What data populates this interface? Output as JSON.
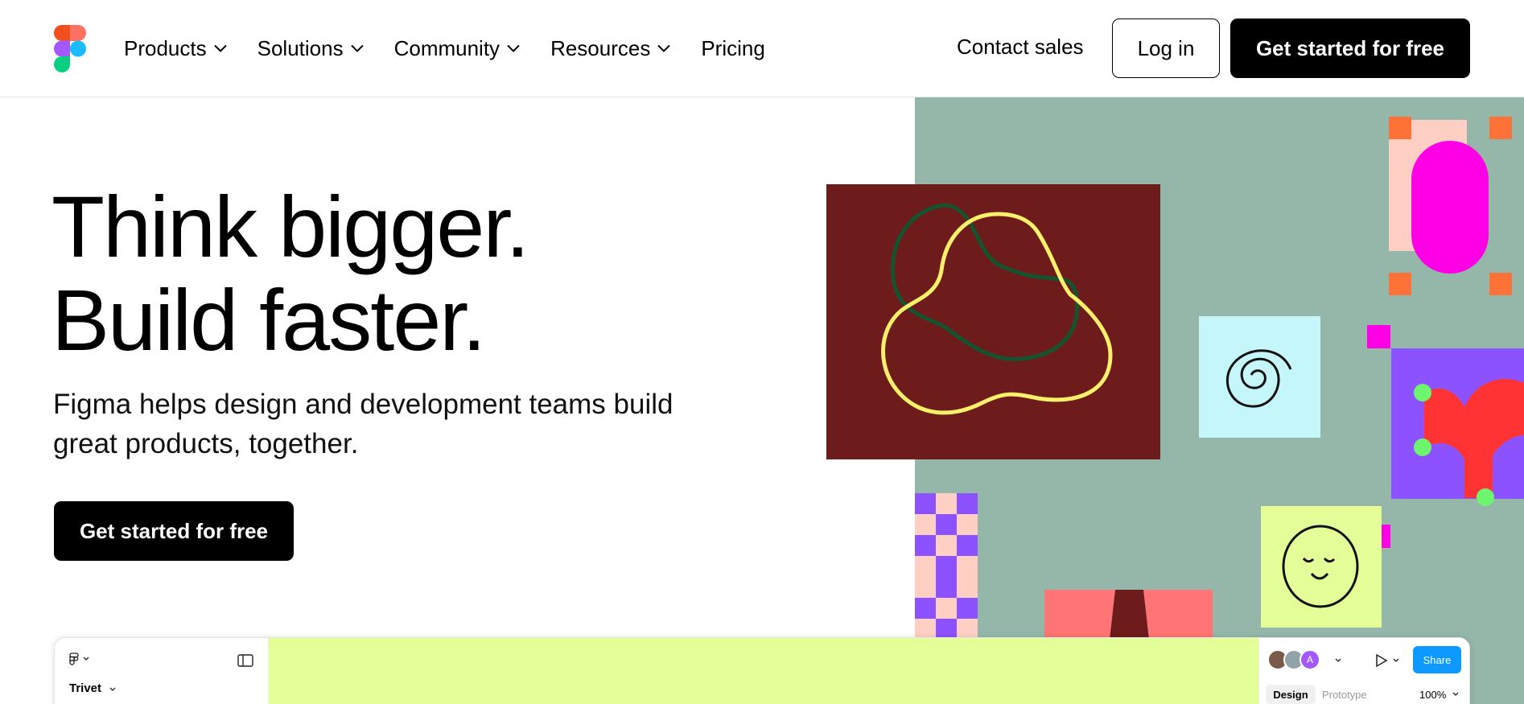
{
  "brand": {
    "colors": {
      "red": "#f24e1e",
      "orange": "#ff7262",
      "purple": "#a259ff",
      "blue": "#1abcfe",
      "green": "#0acf83"
    }
  },
  "nav": {
    "items": [
      {
        "label": "Products",
        "has_menu": true
      },
      {
        "label": "Solutions",
        "has_menu": true
      },
      {
        "label": "Community",
        "has_menu": true
      },
      {
        "label": "Resources",
        "has_menu": true
      },
      {
        "label": "Pricing",
        "has_menu": false
      }
    ],
    "contact_label": "Contact sales",
    "login_label": "Log in",
    "cta_label": "Get started for free"
  },
  "hero": {
    "title_line1": "Think bigger.",
    "title_line2": "Build faster.",
    "subtitle": "Figma helps design and development teams build great products, together.",
    "cta_label": "Get started for free"
  },
  "editor": {
    "file_name": "Trivet",
    "file_sub": " ",
    "share_label": "Share",
    "avatar_letter": "A",
    "tab_design": "Design",
    "tab_prototype": "Prototype",
    "zoom": "100%"
  },
  "art_colors": {
    "background": "#95b7aa",
    "maroon": "#6e1b1b",
    "yellow_line": "#fff06b",
    "green_line": "#14532d",
    "light_blue": "#c4f6fa",
    "magenta": "#ff00e6",
    "peach": "#ffcfc4",
    "orange_handle": "#ff7237",
    "purple": "#8c52ff",
    "red": "#ff3333",
    "lime": "#e4ff97",
    "salmon": "#ff7575"
  }
}
